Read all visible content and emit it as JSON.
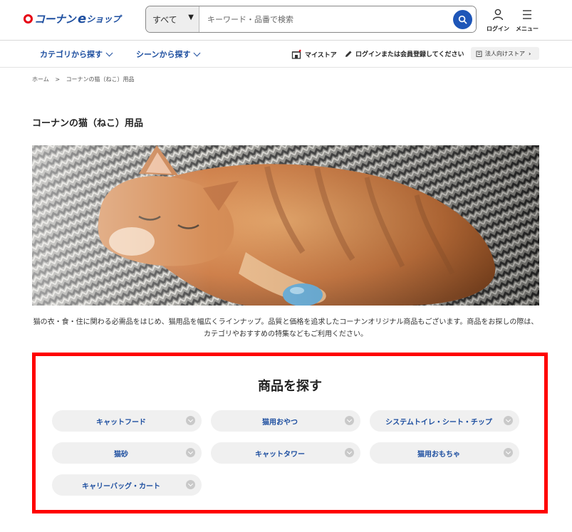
{
  "header": {
    "logo": {
      "brand": "コーナン",
      "e": "e",
      "shop": "ショップ"
    },
    "search": {
      "category": "すべて",
      "placeholder": "キーワード・品番で検索"
    },
    "login_label": "ログイン",
    "menu_label": "メニュー"
  },
  "nav": {
    "category_label": "カテゴリから探す",
    "scene_label": "シーンから探す",
    "mystore_label": "マイストア",
    "login_register_label": "ログインまたは会員登録してください",
    "corporate_label": "法人向けストア"
  },
  "breadcrumb": {
    "home": "ホーム",
    "separator": ">",
    "current": "コーナンの猫（ねこ）用品"
  },
  "page": {
    "title": "コーナンの猫（ねこ）用品",
    "description": "猫の衣・食・住に関わる必需品をはじめ、猫用品を幅広くラインナップ。品質と価格を追求したコーナンオリジナル商品もございます。商品をお探しの際は、カテゴリやおすすめの特集などもご利用ください。"
  },
  "find": {
    "title": "商品を探す",
    "items": [
      {
        "label": "キャットフード"
      },
      {
        "label": "猫用おやつ"
      },
      {
        "label": "システムトイレ・シート・チップ"
      },
      {
        "label": "猫砂"
      },
      {
        "label": "キャットタワー"
      },
      {
        "label": "猫用おもちゃ"
      },
      {
        "label": "キャリーバッグ・カート"
      }
    ]
  },
  "colors": {
    "brand_blue": "#1e4fa0",
    "brand_red": "#e60012",
    "highlight_red": "#ff0000"
  }
}
